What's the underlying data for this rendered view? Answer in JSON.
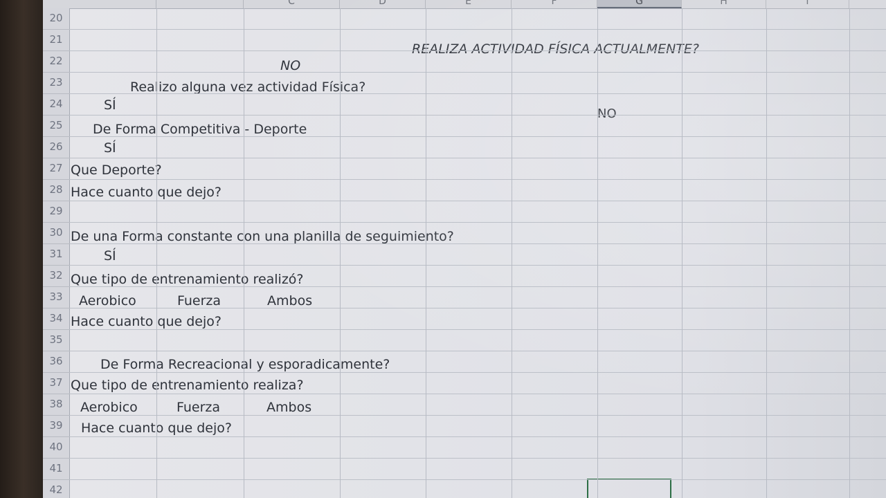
{
  "columns": [
    "",
    "",
    "C",
    "D",
    "E",
    "F",
    "G",
    "H",
    "I"
  ],
  "selected_column": "G",
  "rows": [
    "20",
    "21",
    "22",
    "23",
    "24",
    "25",
    "26",
    "27",
    "28",
    "29",
    "30",
    "31",
    "32",
    "33",
    "34",
    "35",
    "36",
    "37",
    "38",
    "39",
    "40",
    "41",
    "42"
  ],
  "cells": {
    "r21_title": "REALIZA ACTIVIDAD FÍSICA ACTUALMENTE?",
    "r22_no": "NO",
    "r23_question": "Realizo alguna vez actividad Física?",
    "r24_si": "SÍ",
    "r24_no": "NO",
    "r25_competitive": "De Forma Competitiva - Deporte",
    "r26_si": "SÍ",
    "r27_question": "Que Deporte?",
    "r28_question": "Hace cuanto que dejo?",
    "r30_question": "De una Forma constante con una planilla de seguimiento?",
    "r31_si": "SÍ",
    "r32_question": "Que tipo de entrenamiento realizó?",
    "r33_opt1": "Aerobico",
    "r33_opt2": "Fuerza",
    "r33_opt3": "Ambos",
    "r34_question": "Hace cuanto que dejo?",
    "r36_question": "De Forma Recreacional y esporadicamente?",
    "r37_question": "Que tipo de entrenamiento realiza?",
    "r38_opt1": "Aerobico",
    "r38_opt2": "Fuerza",
    "r38_opt3": "Ambos",
    "r39_question": "Hace cuanto que dejo?"
  }
}
